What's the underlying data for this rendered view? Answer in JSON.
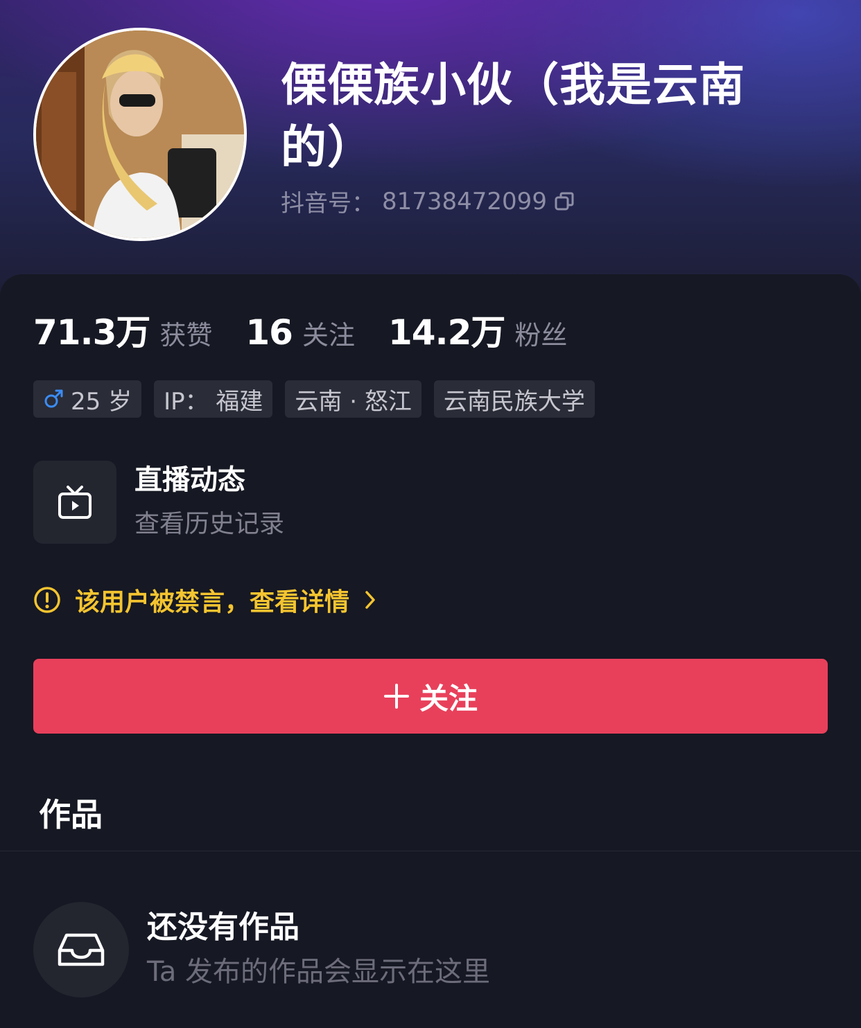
{
  "profile": {
    "name": "傈傈族小伙（我是云南的）",
    "douyin_id_label": "抖音号：",
    "douyin_id": "81738472099"
  },
  "stats": [
    {
      "value": "71.3万",
      "label": "获赞"
    },
    {
      "value": "16",
      "label": "关注"
    },
    {
      "value": "14.2万",
      "label": "粉丝"
    }
  ],
  "tags": {
    "age": "25 岁",
    "ip": "IP：  福建",
    "location": "云南 · 怒江",
    "school": "云南民族大学"
  },
  "live": {
    "title": "直播动态",
    "subtitle": "查看历史记录"
  },
  "ban_notice": "该用户被禁言，查看详情",
  "follow_button": "关注",
  "works": {
    "title": "作品",
    "empty_title": "还没有作品",
    "empty_subtitle": "Ta 发布的作品会显示在这里"
  },
  "colors": {
    "follow": "#e8405b",
    "warning": "#f4c430",
    "male": "#3b8cf5"
  }
}
